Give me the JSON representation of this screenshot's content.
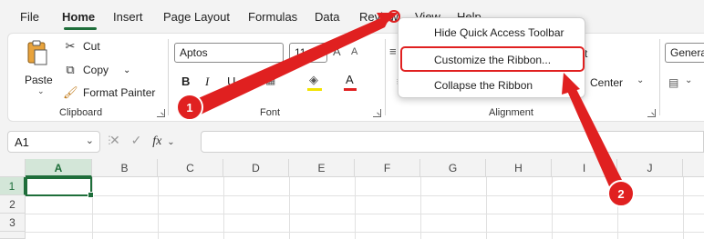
{
  "tabs": [
    {
      "label": "File"
    },
    {
      "label": "Home"
    },
    {
      "label": "Insert"
    },
    {
      "label": "Page Layout"
    },
    {
      "label": "Formulas"
    },
    {
      "label": "Data"
    },
    {
      "label": "Review"
    },
    {
      "label": "View"
    },
    {
      "label": "Help"
    }
  ],
  "ribbon": {
    "clipboard": {
      "paste_label": "Paste",
      "cut_label": "Cut",
      "copy_label": "Copy",
      "format_painter_label": "Format Painter",
      "group_label": "Clipboard"
    },
    "font": {
      "font_name": "Aptos",
      "font_size": "11",
      "bold": "B",
      "italic": "I",
      "group_label": "Font"
    },
    "alignment": {
      "wrap_partial": "t",
      "center_label": "Center",
      "group_label": "Alignment"
    },
    "number": {
      "format_value": "General"
    }
  },
  "context_menu": {
    "items": [
      {
        "label": "Hide Quick Access Toolbar"
      },
      {
        "label": "Customize the Ribbon..."
      },
      {
        "label": "Collapse the Ribbon"
      }
    ]
  },
  "formula_bar": {
    "cell_ref": "A1",
    "fx_label": "fx",
    "value": ""
  },
  "sheet": {
    "columns": [
      "A",
      "B",
      "C",
      "D",
      "E",
      "F",
      "G",
      "H",
      "I",
      "J"
    ],
    "rows": [
      "1",
      "2",
      "3"
    ],
    "active_cell": "A1"
  },
  "annotations": [
    {
      "label": "1"
    },
    {
      "label": "2"
    }
  ],
  "colors": {
    "accent": "#1e6e3a",
    "annotation": "#e02020"
  }
}
